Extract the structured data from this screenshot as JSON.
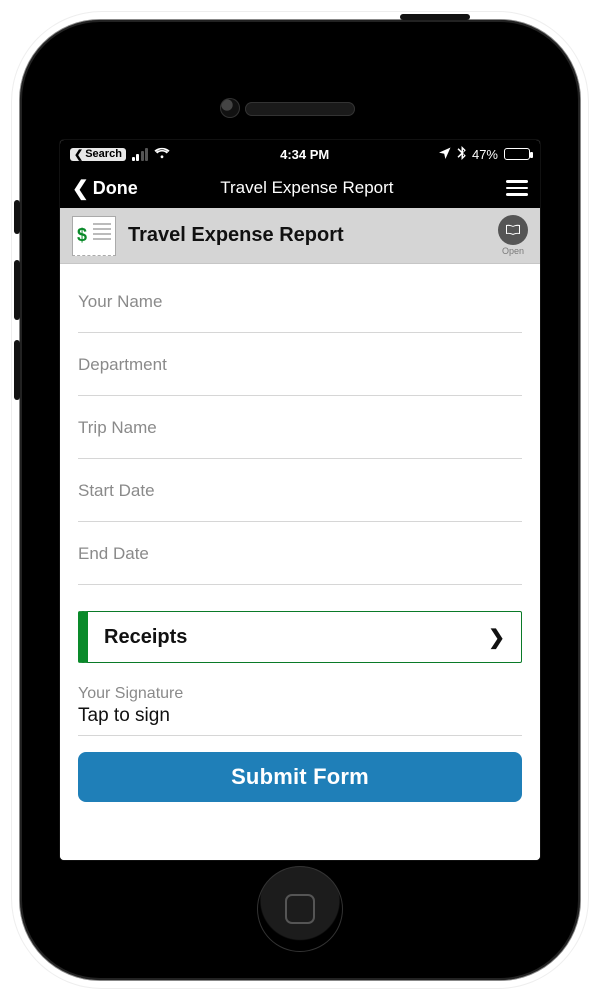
{
  "status": {
    "back_app": "Search",
    "time": "4:34 PM",
    "battery_pct": "47%",
    "icons": {
      "location": "location-arrow",
      "bluetooth": "bluetooth",
      "wifi": "wifi",
      "signal": "cellular-signal"
    }
  },
  "navbar": {
    "back_label": "Done",
    "title": "Travel Expense Report",
    "menu": "hamburger"
  },
  "doc_header": {
    "title": "Travel Expense Report",
    "open_label": "Open",
    "icon": "receipt-dollar"
  },
  "form": {
    "fields": [
      {
        "placeholder": "Your Name"
      },
      {
        "placeholder": "Department"
      },
      {
        "placeholder": "Trip Name"
      },
      {
        "placeholder": "Start Date"
      },
      {
        "placeholder": "End Date"
      }
    ],
    "receipts_label": "Receipts",
    "signature": {
      "label": "Your Signature",
      "value": "Tap to sign"
    },
    "submit_label": "Submit Form"
  }
}
